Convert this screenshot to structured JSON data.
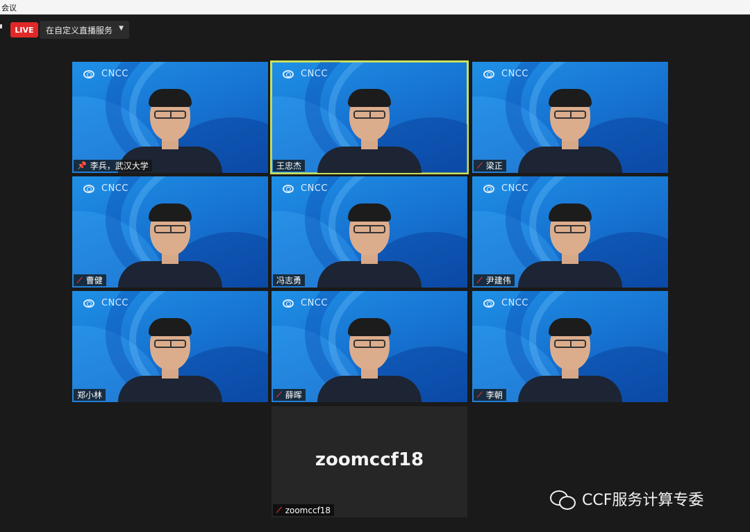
{
  "window": {
    "title": "会议"
  },
  "toolbar": {
    "live_label": "LIVE",
    "stream_label": "在自定义直播服务",
    "stream_chevron": "▼"
  },
  "colors": {
    "live_red": "#e02828",
    "active_speaker_outline": "#c8e05a",
    "tile_blue": "#1670cf",
    "muted_red": "#e33333"
  },
  "icons": {
    "pin": "pin-icon",
    "muted": "mic-muted-icon",
    "logo": "cncc-emblem-icon",
    "watermark": "wechat-icon"
  },
  "gallery": {
    "logo_text": "CNCC",
    "tiles": [
      {
        "name": "李兵，武汉大学",
        "pinned": true,
        "muted": false,
        "active": false
      },
      {
        "name": "王忠杰",
        "pinned": false,
        "muted": false,
        "active": true
      },
      {
        "name": "梁正",
        "pinned": false,
        "muted": true,
        "active": false
      },
      {
        "name": "曹健",
        "pinned": false,
        "muted": true,
        "active": false
      },
      {
        "name": "冯志勇",
        "pinned": false,
        "muted": false,
        "active": false
      },
      {
        "name": "尹建伟",
        "pinned": false,
        "muted": true,
        "active": false
      },
      {
        "name": "郑小林",
        "pinned": false,
        "muted": false,
        "active": false
      },
      {
        "name": "薛晖",
        "pinned": false,
        "muted": true,
        "active": false
      },
      {
        "name": "李朝",
        "pinned": false,
        "muted": true,
        "active": false
      }
    ],
    "no_video_participant": {
      "display_name": "zoomccf18",
      "tag_name": "zoomccf18",
      "muted": true
    }
  },
  "watermark": {
    "text": "CCF服务计算专委"
  }
}
